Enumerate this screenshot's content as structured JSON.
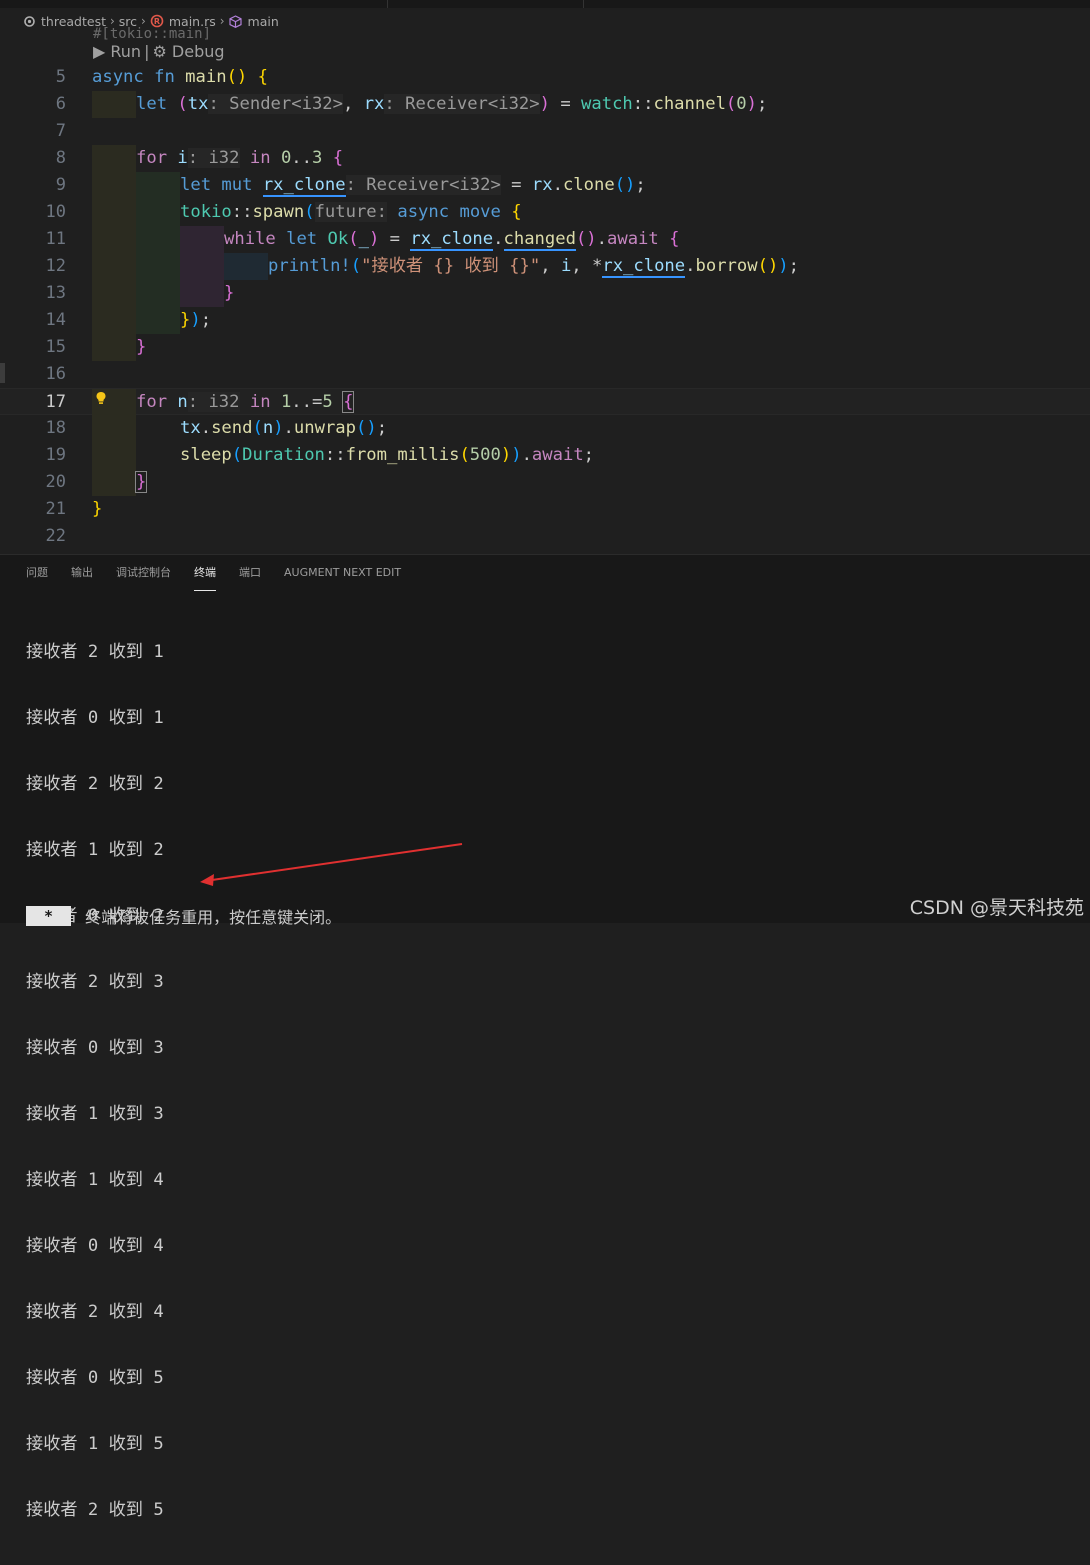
{
  "breadcrumb": {
    "items": [
      {
        "label": "threadtest",
        "icon": "folder-gear-icon"
      },
      {
        "label": "src",
        "icon": ""
      },
      {
        "label": "main.rs",
        "icon": "rust-file-icon"
      },
      {
        "label": "main",
        "icon": "cube-icon"
      }
    ]
  },
  "codelens": {
    "partial_line": "#[tokio::main]",
    "run": "▶ Run",
    "separator": "|",
    "debug": "⚙ Debug"
  },
  "line_numbers": [
    "5",
    "6",
    "7",
    "8",
    "9",
    "10",
    "11",
    "12",
    "13",
    "14",
    "15",
    "16",
    "17",
    "18",
    "19",
    "20",
    "21",
    "22"
  ],
  "active_line": "17",
  "panel": {
    "tabs": [
      "问题",
      "输出",
      "调试控制台",
      "终端",
      "端口",
      "AUGMENT NEXT EDIT"
    ],
    "active_tab": "终端"
  },
  "terminal": {
    "lines": [
      "接收者 2 收到 1",
      "接收者 0 收到 1",
      "接收者 2 收到 2",
      "接收者 1 收到 2",
      "接收者 0 收到 2",
      "接收者 2 收到 3",
      "接收者 0 收到 3",
      "接收者 1 收到 3",
      "接收者 1 收到 4",
      "接收者 0 收到 4",
      "接收者 2 收到 4",
      "接收者 0 收到 5",
      "接收者 1 收到 5",
      "接收者 2 收到 5"
    ],
    "footer_badge": " * ",
    "footer_text": "终端将被任务重用，按任意键关闭。"
  },
  "watermark": "CSDN @景天科技苑",
  "colors": {
    "background": "#1f1f1f",
    "keyword": "#569cd6",
    "control": "#c586c0",
    "function": "#dcdcaa",
    "type": "#4ec9b0",
    "variable": "#9cdcfe",
    "string": "#ce9178",
    "annotation_arrow": "#e03030"
  }
}
